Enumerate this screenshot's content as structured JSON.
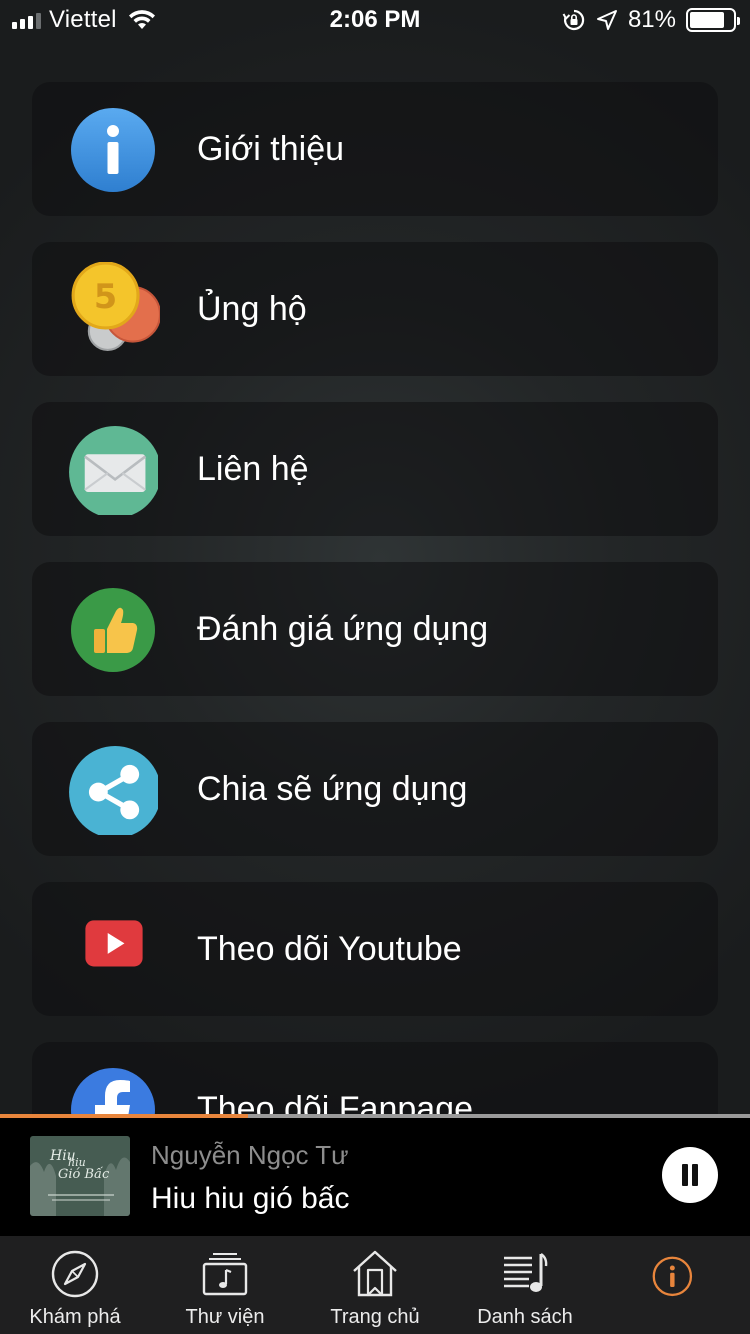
{
  "status_bar": {
    "carrier": "Viettel",
    "time": "2:06 PM",
    "battery": "81%",
    "battery_level": 0.81
  },
  "menu": [
    {
      "label": "Giới thiệu",
      "icon": "info-icon"
    },
    {
      "label": "Ủng hộ",
      "icon": "coins-icon"
    },
    {
      "label": "Liên hệ",
      "icon": "mail-icon"
    },
    {
      "label": "Đánh giá ứng dụng",
      "icon": "thumbs-up-icon"
    },
    {
      "label": "Chia sẽ ứng dụng",
      "icon": "share-icon"
    },
    {
      "label": "Theo dõi Youtube",
      "icon": "youtube-icon"
    },
    {
      "label": "Theo dõi Fanpage",
      "icon": "facebook-icon"
    }
  ],
  "player": {
    "artist": "Nguyễn Ngọc Tư",
    "title": "Hiu hiu gió bấc",
    "progress": 0.33,
    "state": "playing"
  },
  "tabs": [
    {
      "label": "Khám phá",
      "icon": "compass-icon"
    },
    {
      "label": "Thư viện",
      "icon": "library-icon"
    },
    {
      "label": "Trang chủ",
      "icon": "home-icon"
    },
    {
      "label": "Danh sách",
      "icon": "playlist-icon"
    },
    {
      "label": "",
      "icon": "info-circle-icon",
      "active": true
    }
  ],
  "colors": {
    "accent": "#e8853c",
    "info_icon": "#3d8fdb",
    "mail_icon": "#5fb894",
    "thumbs_icon": "#3a9a47",
    "share_icon": "#4ab3d3",
    "youtube_icon": "#e03a3e",
    "facebook_icon": "#3b7be0"
  }
}
